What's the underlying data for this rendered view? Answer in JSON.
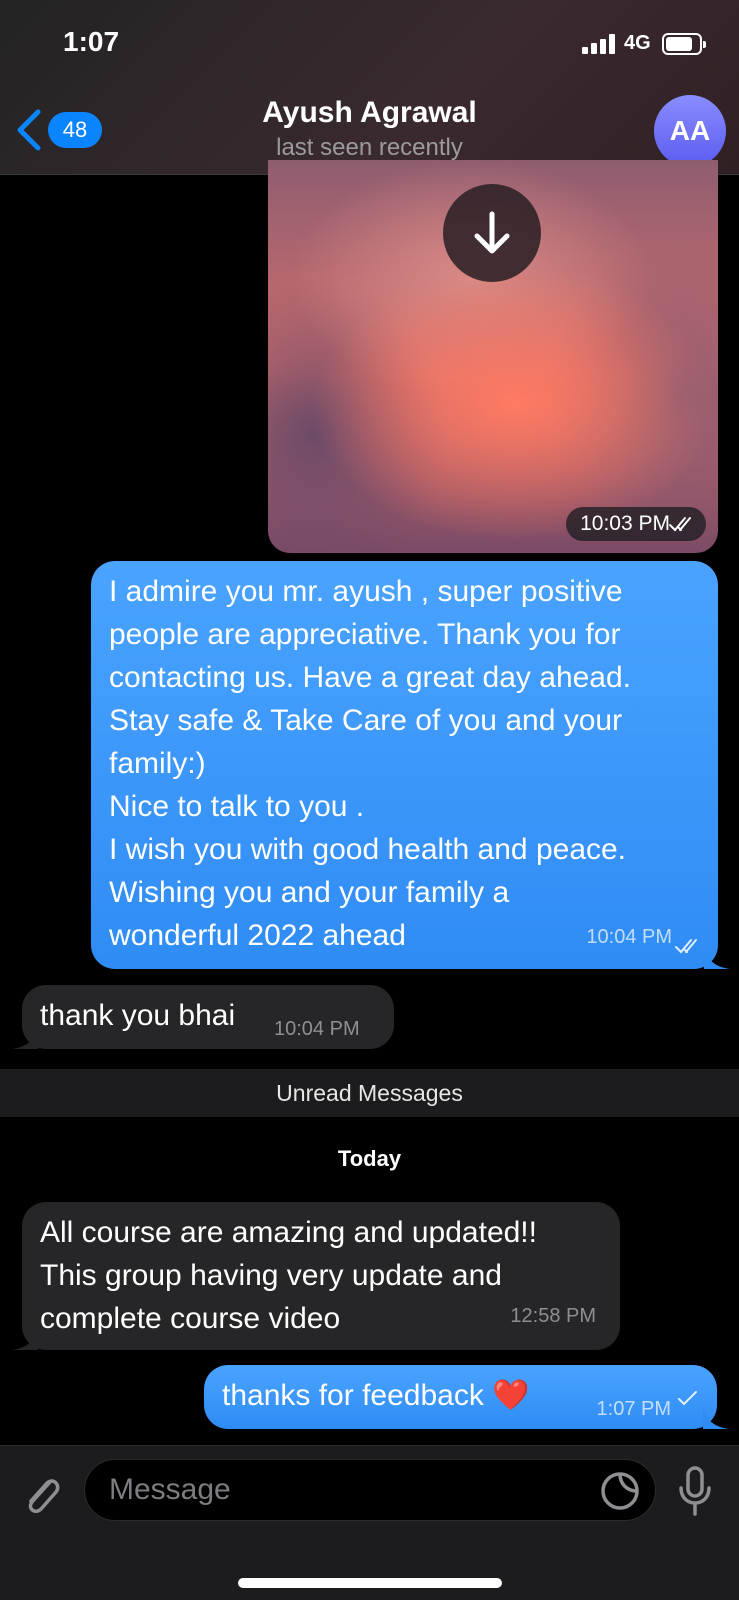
{
  "status_bar": {
    "time": "1:07",
    "network": "4G",
    "battery_level": 0.8
  },
  "header": {
    "back_count": "48",
    "contact_name": "Ayush Agrawal",
    "contact_status": "last seen recently",
    "avatar_initials": "AA"
  },
  "messages": {
    "photo": {
      "time": "10:03 PM",
      "read": true
    },
    "m1": {
      "direction": "outgoing",
      "text": "I admire you mr. ayush , super positive\npeople are appreciative. Thank you for\ncontacting us. Have a great day ahead.\nStay safe & Take Care of you and your\nfamily:)\nNice to talk to you .\nI wish you with good health and peace.\nWishing you and your family a\nwonderful 2022 ahead",
      "time": "10:04 PM",
      "read": true
    },
    "m2": {
      "direction": "incoming",
      "text": "thank you bhai",
      "time": "10:04 PM"
    },
    "unread_label": "Unread Messages",
    "date_separator": "Today",
    "m3": {
      "direction": "incoming",
      "text": "All course are amazing and updated!!\nThis group having very update and\ncomplete course video",
      "time": "12:58 PM"
    },
    "m4": {
      "direction": "outgoing",
      "text": "thanks for feedback ❤️",
      "time": "1:07 PM",
      "read": false
    }
  },
  "composer": {
    "placeholder": "Message"
  },
  "colors": {
    "accent": "#0a84ff",
    "outgoing_bubble": "#3a97fa",
    "incoming_bubble": "#262628",
    "avatar": "#6e6ff5"
  }
}
